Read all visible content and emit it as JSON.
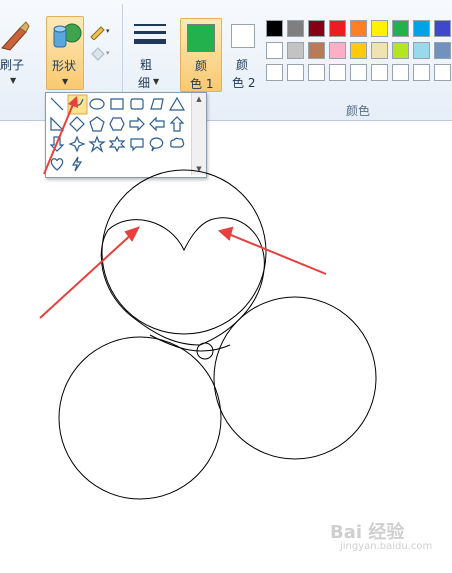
{
  "toolbar": {
    "brush_label": "刷子",
    "shapes_label": "形状",
    "size_label_1": "粗",
    "size_label_2": "细",
    "color1_label_1": "颜",
    "color1_label_2": "色 1",
    "color2_label_1": "颜",
    "color2_label_2": "色 2",
    "colors_group_label": "颜色"
  },
  "colors": {
    "color1": "#22b14c",
    "color2": "#ffffff",
    "palette_row1": [
      "#000000",
      "#7f7f7f",
      "#880015",
      "#ed1c24",
      "#ff7f27",
      "#fff200",
      "#22b14c",
      "#00a2e8",
      "#3f48cc"
    ],
    "palette_row2": [
      "#ffffff",
      "#c3c3c3",
      "#b97a57",
      "#ffaec9",
      "#ffc90e",
      "#efe4b0",
      "#b5e61d",
      "#99d9ea",
      "#7092be"
    ],
    "palette_row3": [
      "#ffffff",
      "#ffffff",
      "#ffffff",
      "#ffffff",
      "#ffffff",
      "#ffffff",
      "#ffffff",
      "#ffffff",
      "#ffffff"
    ]
  },
  "shapes_menu": {
    "selected": "curve",
    "shapes": [
      "line",
      "curve",
      "oval",
      "rectangle",
      "rounded-rectangle",
      "polygon",
      "triangle",
      "right-triangle",
      "diamond",
      "pentagon",
      "hexagon",
      "arrow-right",
      "arrow-left",
      "arrow-up",
      "arrow-down",
      "four-point-star",
      "five-point-star",
      "six-point-star",
      "rounded-callout",
      "oval-callout",
      "cloud-callout",
      "heart",
      "lightning"
    ]
  },
  "watermark": {
    "text": "Bai 经验",
    "sub": "jingyan.baidu.com"
  }
}
